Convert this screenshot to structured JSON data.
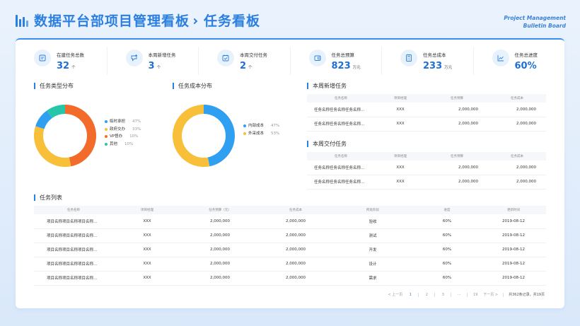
{
  "header": {
    "title_main": "数据平台部项目管理看板",
    "title_sub": "任务看板",
    "subtitle_en_line1": "Project Management",
    "subtitle_en_line2": "Bulletin Board"
  },
  "stats": [
    {
      "label": "在建任务总数",
      "value": "32",
      "unit": "个",
      "icon": "list-icon"
    },
    {
      "label": "本周新增任务",
      "value": "3",
      "unit": "个",
      "icon": "new-task-icon"
    },
    {
      "label": "本周交付任务",
      "value": "2",
      "unit": "个",
      "icon": "calendar-check-icon"
    },
    {
      "label": "任务总预算",
      "value": "823",
      "unit": "万元",
      "icon": "wallet-icon"
    },
    {
      "label": "任务总成本",
      "value": "233",
      "unit": "万元",
      "icon": "calculator-icon"
    },
    {
      "label": "任务总进度",
      "value": "60%",
      "unit": "",
      "icon": "trend-chart-icon"
    }
  ],
  "sections": {
    "type_dist": "任务类型分布",
    "cost_dist": "任务成本分布",
    "weekly_new": "本周新增任务",
    "weekly_delivered": "本周交付任务",
    "task_list": "任务列表"
  },
  "chart_data": [
    {
      "type": "pie",
      "title": "任务类型分布",
      "categories": [
        "临时承担",
        "政府交办",
        "VP督办",
        "其他"
      ],
      "values": [
        47,
        33,
        10,
        10
      ],
      "labels": [
        "47%",
        "33%",
        "10%",
        "10%"
      ],
      "colors": [
        "#f26b2a",
        "#f8bf38",
        "#2f9ff2",
        "#26c6a8"
      ]
    },
    {
      "type": "pie",
      "title": "任务成本分布",
      "categories": [
        "内部成本",
        "外采成本"
      ],
      "values": [
        47,
        53
      ],
      "labels": [
        "47%",
        "53%"
      ],
      "colors": [
        "#2f9ff2",
        "#f8bf38"
      ]
    }
  ],
  "small_table_headers": [
    "任务名称",
    "项目经理",
    "任务预算",
    "任务成本"
  ],
  "weekly_new_rows": [
    [
      "任务名称任务名称任务名称...",
      "XXX",
      "2,000,000",
      "2,000,000"
    ],
    [
      "任务名称任务名称任务名称...",
      "XXX",
      "2,000,000",
      "2,000,000"
    ]
  ],
  "weekly_delivered_rows": [
    [
      "任务名称任务名称任务名称...",
      "XXX",
      "2,000,000",
      "2,000,000"
    ],
    [
      "任务名称任务名称任务名称...",
      "XXX",
      "2,000,000",
      "2,000,000"
    ]
  ],
  "task_table_headers": [
    "任务名称",
    "项目经理",
    "任务预算（元）",
    "任务成本",
    "所处阶段",
    "进度",
    "更新时间"
  ],
  "task_rows": [
    [
      "项目名称项目名称项目名称...",
      "XXX",
      "2,000,000",
      "2,000,000",
      "验收",
      "60%",
      "2019-08-12"
    ],
    [
      "项目名称项目名称项目名称...",
      "XXX",
      "2,000,000",
      "2,000,000",
      "测试",
      "60%",
      "2019-08-12"
    ],
    [
      "项目名称项目名称项目名称...",
      "XXX",
      "2,000,000",
      "2,000,000",
      "开发",
      "60%",
      "2019-08-12"
    ],
    [
      "项目名称项目名称项目名称...",
      "XXX",
      "2,000,000",
      "2,000,000",
      "设计",
      "60%",
      "2019-08-12"
    ],
    [
      "项目名称项目名称项目名称...",
      "XXX",
      "2,000,000",
      "2,000,000",
      "需求",
      "60%",
      "2019-08-12"
    ]
  ],
  "pagination": {
    "prev": "< 上一页",
    "pages": [
      "1",
      "2",
      "3",
      "···",
      "19"
    ],
    "current": "1",
    "next": "下一页 >",
    "summary": "共362条记录，共19页"
  },
  "colors": {
    "accent": "#2b7fe0",
    "number": "#1f6fd6"
  }
}
